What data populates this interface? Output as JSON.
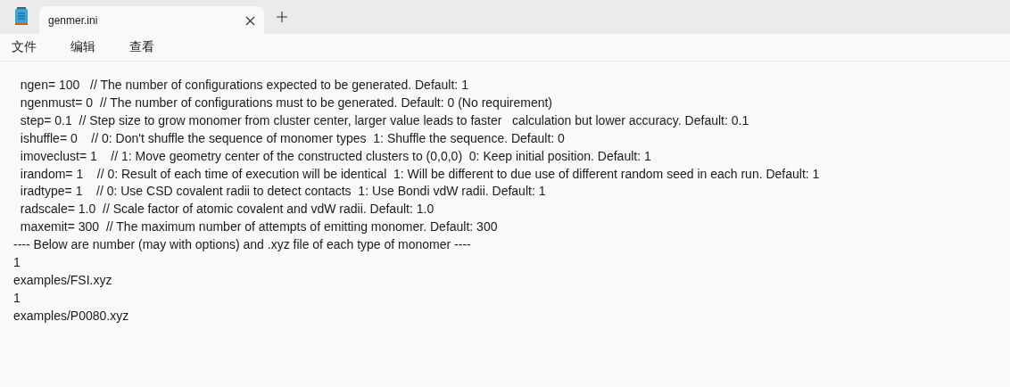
{
  "tabs": [
    {
      "label": "genmer.ini",
      "selected": true
    }
  ],
  "menu": [
    "文件",
    "编辑",
    "查看"
  ],
  "lines": [
    "  ngen= 100   // The number of configurations expected to be generated. Default: 1",
    "  ngenmust= 0  // The number of configurations must to be generated. Default: 0 (No requirement)",
    "  step= 0.1  // Step size to grow monomer from cluster center, larger value leads to faster   calculation but lower accuracy. Default: 0.1",
    "  ishuffle= 0    // 0: Don't shuffle the sequence of monomer types  1: Shuffle the sequence. Default: 0",
    "  imoveclust= 1    // 1: Move geometry center of the constructed clusters to (0,0,0)  0: Keep initial position. Default: 1",
    "  irandom= 1    // 0: Result of each time of execution will be identical  1: Will be different to due use of different random seed in each run. Default: 1",
    "  iradtype= 1    // 0: Use CSD covalent radii to detect contacts  1: Use Bondi vdW radii. Default: 1",
    "  radscale= 1.0  // Scale factor of atomic covalent and vdW radii. Default: 1.0",
    "  maxemit= 300  // The maximum number of attempts of emitting monomer. Default: 300",
    "---- Below are number (may with options) and .xyz file of each type of monomer ----",
    "1",
    "examples/FSI.xyz",
    "1",
    "examples/P0080.xyz"
  ]
}
